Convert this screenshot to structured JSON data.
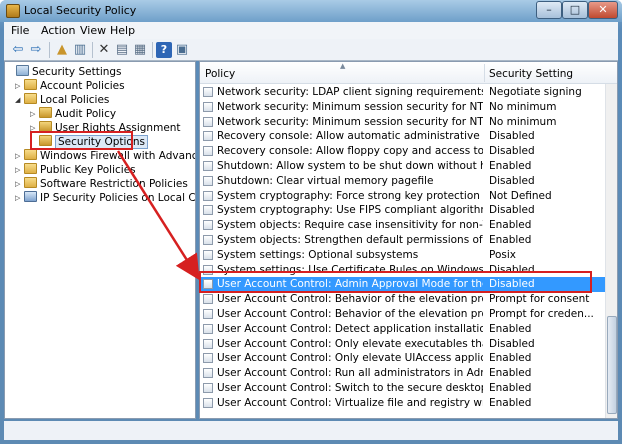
{
  "window": {
    "title": "Local Security Policy"
  },
  "window_controls": {
    "minimize": "–",
    "maximize": "□",
    "close": "✕"
  },
  "menu": [
    {
      "label": "File"
    },
    {
      "label": "Action"
    },
    {
      "label": "View"
    },
    {
      "label": "Help"
    }
  ],
  "toolbar": [
    {
      "icon": "back-arrow-icon",
      "glyph": "⇦"
    },
    {
      "icon": "forward-arrow-icon",
      "glyph": "⇨"
    },
    {
      "icon": "up-folder-icon",
      "glyph": "▲"
    },
    {
      "icon": "show-tree-icon",
      "glyph": "▥"
    },
    {
      "icon": "delete-icon",
      "glyph": "✕"
    },
    {
      "icon": "properties-icon",
      "glyph": "▤"
    },
    {
      "icon": "export-list-icon",
      "glyph": "▦"
    },
    {
      "icon": "help-icon",
      "glyph": "?"
    },
    {
      "icon": "help-topics-icon",
      "glyph": "▣"
    }
  ],
  "tree": [
    {
      "label": "Security Settings",
      "depth": 0,
      "expander": "",
      "icon": "security-settings-icon"
    },
    {
      "label": "Account Policies",
      "depth": 1,
      "expander": "▷",
      "icon": "folder-icon"
    },
    {
      "label": "Local Policies",
      "depth": 1,
      "expander": "◢",
      "icon": "folder-icon"
    },
    {
      "label": "Audit Policy",
      "depth": 2,
      "expander": "▷",
      "icon": "folder-lock-icon"
    },
    {
      "label": "User Rights Assignment",
      "depth": 2,
      "expander": "▷",
      "icon": "folder-lock-icon"
    },
    {
      "label": "Security Options",
      "depth": 2,
      "expander": "",
      "icon": "folder-lock-icon",
      "selected": true
    },
    {
      "label": "Windows Firewall with Advanced Secu",
      "depth": 1,
      "expander": "▷",
      "icon": "folder-icon"
    },
    {
      "label": "Public Key Policies",
      "depth": 1,
      "expander": "▷",
      "icon": "folder-icon"
    },
    {
      "label": "Software Restriction Policies",
      "depth": 1,
      "expander": "▷",
      "icon": "folder-icon"
    },
    {
      "label": "IP Security Policies on Local Compute",
      "depth": 1,
      "expander": "▷",
      "icon": "network-policy-icon"
    }
  ],
  "list": {
    "columns": {
      "policy": "Policy",
      "setting": "Security Setting"
    },
    "rows": [
      {
        "policy": "Network security: LDAP client signing requirements",
        "setting": "Negotiate signing"
      },
      {
        "policy": "Network security: Minimum session security for NTLM SSP bas...",
        "setting": "No minimum"
      },
      {
        "policy": "Network security: Minimum session security for NTLM SSP bas...",
        "setting": "No minimum"
      },
      {
        "policy": "Recovery console: Allow automatic administrative logon",
        "setting": "Disabled"
      },
      {
        "policy": "Recovery console: Allow floppy copy and access to all drives an...",
        "setting": "Disabled"
      },
      {
        "policy": "Shutdown: Allow system to be shut down without having to lo...",
        "setting": "Enabled"
      },
      {
        "policy": "Shutdown: Clear virtual memory pagefile",
        "setting": "Disabled"
      },
      {
        "policy": "System cryptography: Force strong key protection for user keys...",
        "setting": "Not Defined"
      },
      {
        "policy": "System cryptography: Use FIPS compliant algorithms for encry...",
        "setting": "Disabled"
      },
      {
        "policy": "System objects: Require case insensitivity for non-Windows su...",
        "setting": "Enabled"
      },
      {
        "policy": "System objects: Strengthen default permissions of internal syst...",
        "setting": "Enabled"
      },
      {
        "policy": "System settings: Optional subsystems",
        "setting": "Posix"
      },
      {
        "policy": "System settings: Use Certificate Rules on Windows Executables ...",
        "setting": "Disabled"
      },
      {
        "policy": "User Account Control: Admin Approval Mode for the Built-in A...",
        "setting": "Disabled",
        "selected": true
      },
      {
        "policy": "User Account Control: Behavior of the elevation prompt for ad...",
        "setting": "Prompt for consent"
      },
      {
        "policy": "User Account Control: Behavior of the elevation prompt for sta...",
        "setting": "Prompt for creden..."
      },
      {
        "policy": "User Account Control: Detect application installations and pro...",
        "setting": "Enabled"
      },
      {
        "policy": "User Account Control: Only elevate executables that are signed ...",
        "setting": "Disabled"
      },
      {
        "policy": "User Account Control: Only elevate UIAccess applications that ...",
        "setting": "Enabled"
      },
      {
        "policy": "User Account Control: Run all administrators in Admin Approv...",
        "setting": "Enabled"
      },
      {
        "policy": "User Account Control: Switch to the secure desktop when pro...",
        "setting": "Enabled"
      },
      {
        "policy": "User Account Control: Virtualize file and registry write failures t...",
        "setting": "Enabled"
      }
    ]
  },
  "colors": {
    "selection": "#3399ff",
    "annotation": "#d62020"
  }
}
